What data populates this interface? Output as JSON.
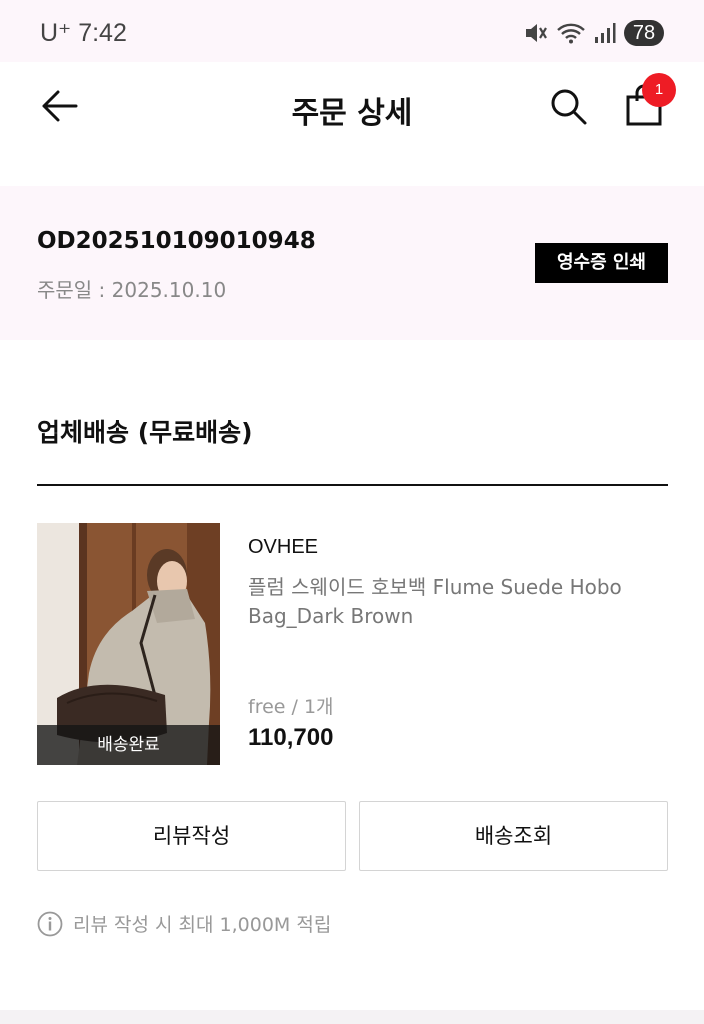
{
  "status_bar": {
    "time": "U⁺ 7:42",
    "battery": "78"
  },
  "header": {
    "title": "주문 상세",
    "cart_count": "1"
  },
  "order": {
    "id": "OD202510109010948",
    "date": "주문일 : 2025.10.10",
    "receipt_button": "영수증 인쇄"
  },
  "shipment": {
    "section_title": "업체배송 (무료배송)"
  },
  "product": {
    "status": "배송완료",
    "brand": "OVHEE",
    "name": "플럼 스웨이드 호보백 Flume Suede Hobo Bag_Dark Brown",
    "option": "free / 1개",
    "price": "110,700"
  },
  "actions": {
    "review": "리뷰작성",
    "tracking": "배송조회"
  },
  "notice": {
    "text": "리뷰 작성 시 최대 1,000M 적립"
  },
  "colors": {
    "accent_badge": "#ee1c25",
    "page_tint": "#fdf6fb",
    "receipt_button": "#000000"
  },
  "icons": [
    "back-arrow-icon",
    "search-icon",
    "shopping-bag-icon",
    "mute-icon",
    "wifi-icon",
    "signal-icon",
    "info-icon"
  ]
}
